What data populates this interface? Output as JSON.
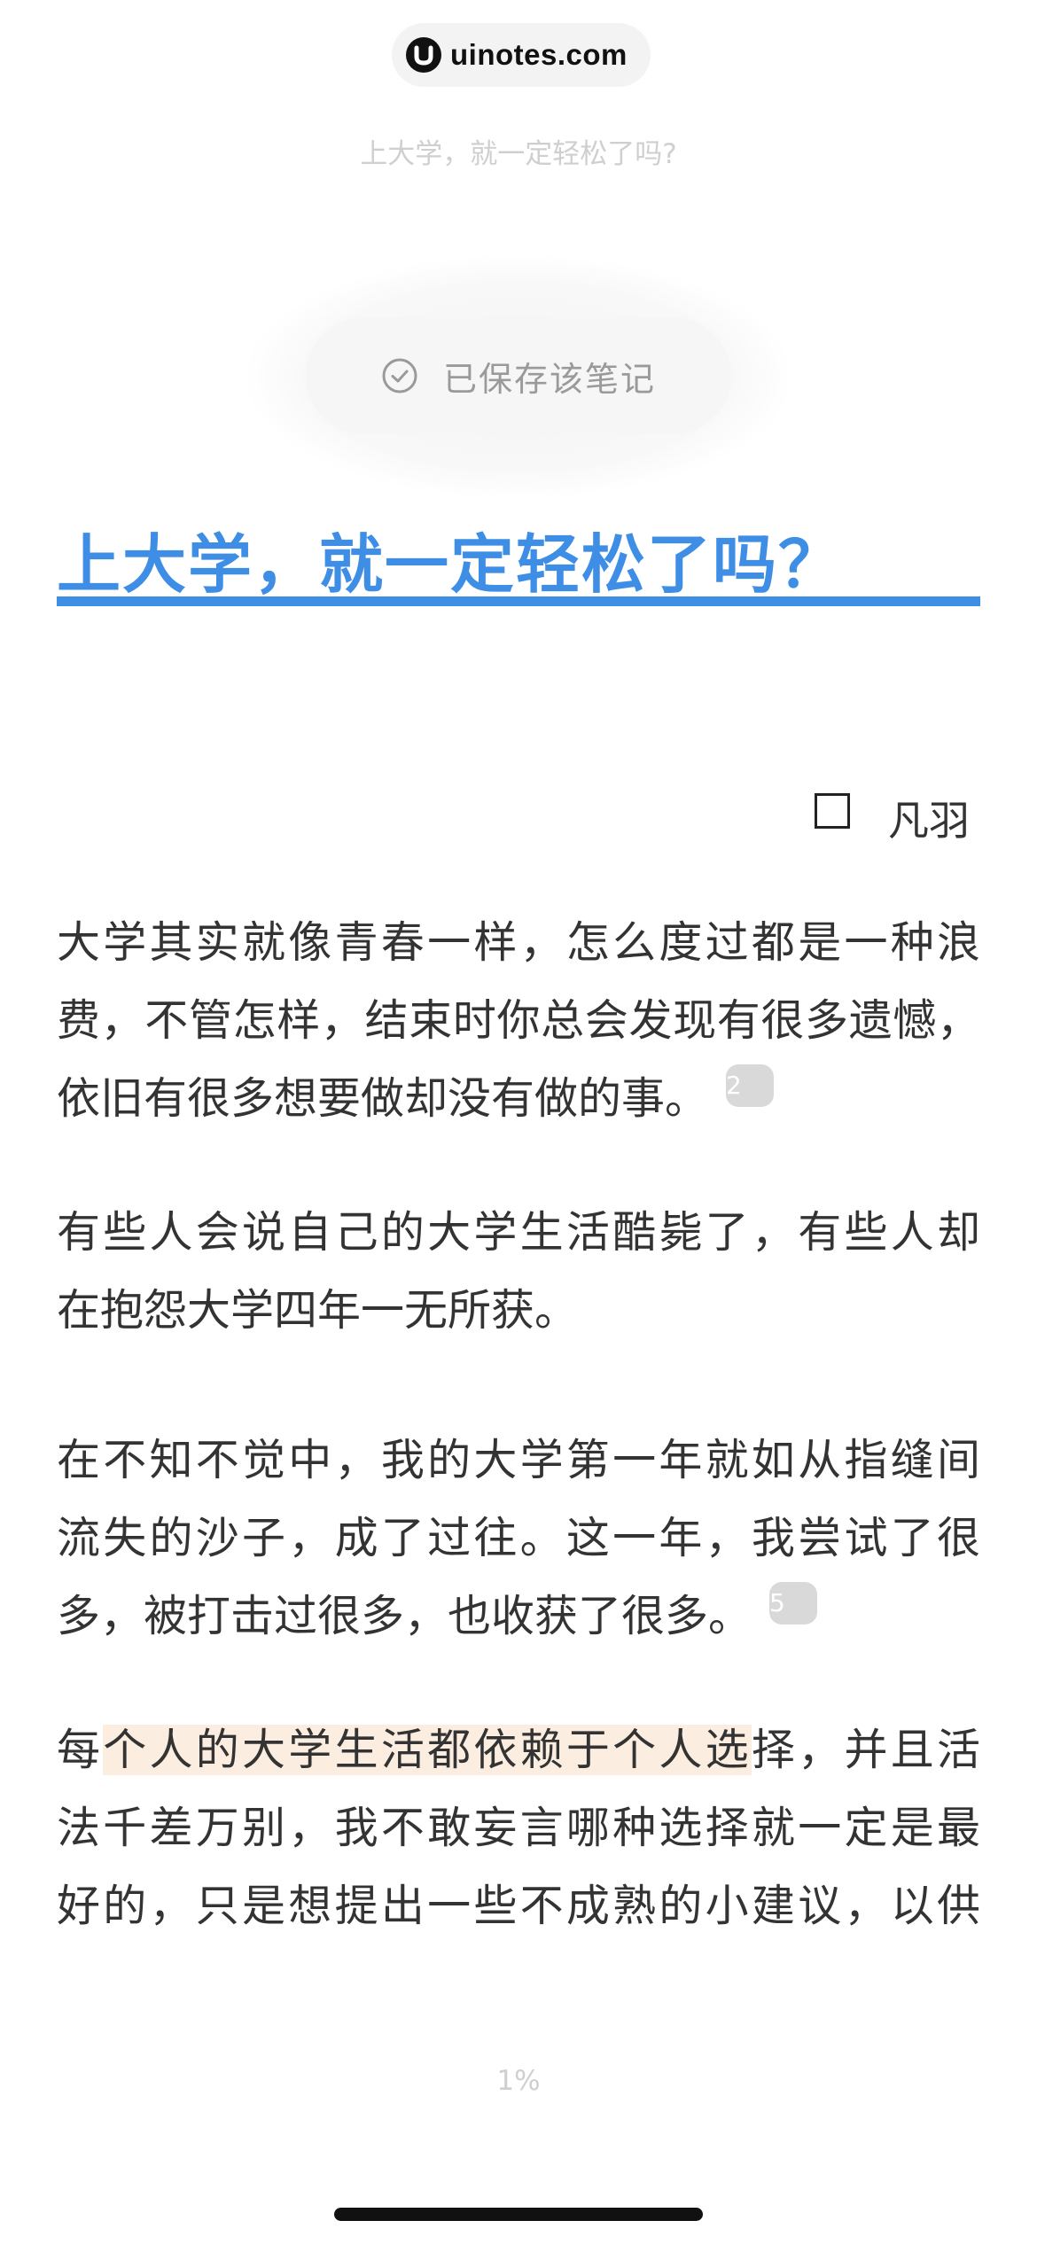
{
  "brand": {
    "text": "uinotes.com"
  },
  "header": {
    "note_title": "上大学，就一定轻松了吗?"
  },
  "toast": {
    "text": "已保存该笔记",
    "icon": "check-circle-icon"
  },
  "article": {
    "title": "上大学，就一定轻松了吗？",
    "accent_color": "#3f8ee6",
    "author": "凡羽",
    "paragraphs": [
      {
        "lines": [
          "大学其实就像青春一样，怎么度过都是一种浪",
          "费，不管怎样，结束时你总会发现有很多遗憾，",
          "依旧有很多想要做却没有做的事。"
        ],
        "comment_count": "2"
      },
      {
        "lines": [
          "有些人会说自己的大学生活酷毙了，有些人却",
          "在抱怨大学四年一无所获。"
        ]
      },
      {
        "lines": [
          "在不知不觉中，我的大学第一年就如从指缝间",
          "流失的沙子，成了过往。这一年，我尝试了很",
          "多，被打击过很多，也收获了很多。"
        ],
        "comment_count": "5"
      },
      {
        "line1_prefix": "每",
        "line1_highlight": "个人的大学生活都依赖于个人选",
        "line1_suffix": "择，并且活",
        "lines": [
          "法千差万别，我不敢妄言哪种选择就一定是最",
          "好的，只是想提出一些不成熟的小建议，以供"
        ],
        "highlight_color": "#fbeee0"
      }
    ]
  },
  "footer": {
    "progress": "1%"
  }
}
